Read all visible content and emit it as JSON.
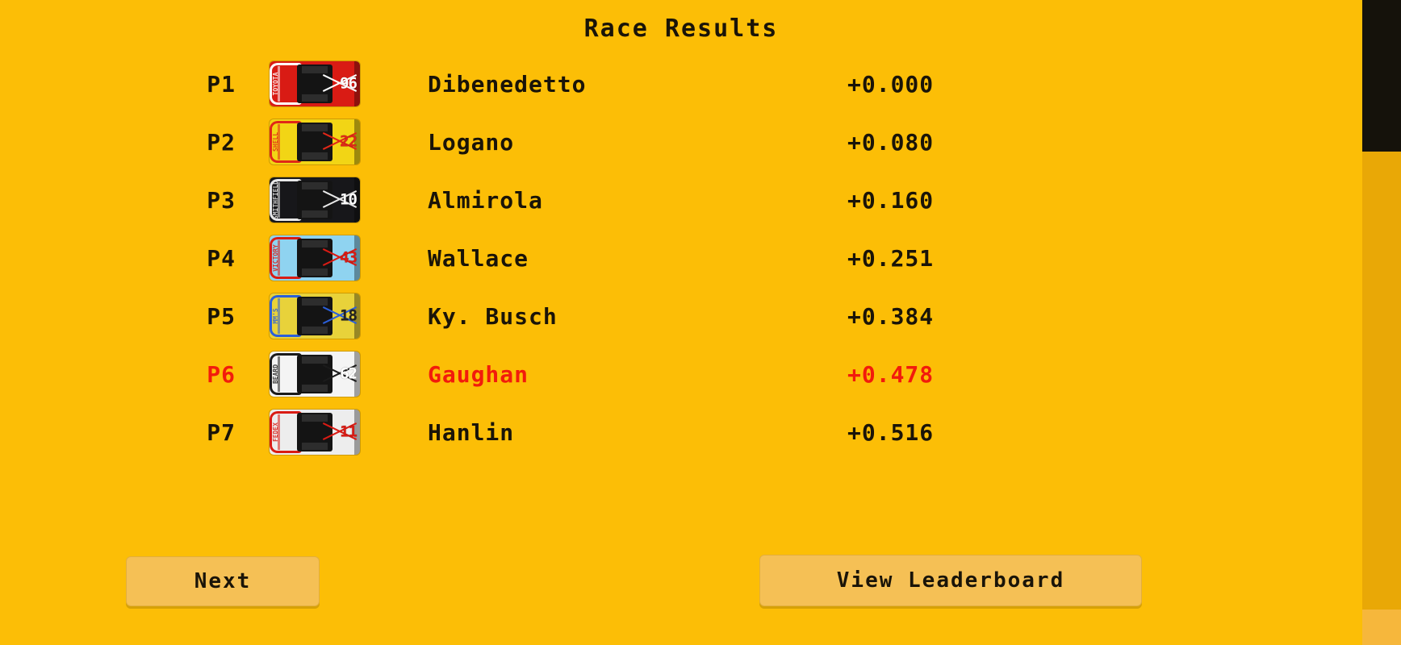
{
  "screen": {
    "title": "Race Results",
    "background_color": "#FCBE06",
    "text_color": "#1a1408",
    "highlight_color": "#F21B0C"
  },
  "results": {
    "rows": [
      {
        "position": "P1",
        "driver": "Dibenedetto",
        "gap": "+0.000",
        "highlighted": false,
        "car": {
          "number": "96",
          "body_color": "#D91B14",
          "accent_color": "#FFFFFF",
          "number_color": "#FFFFFF",
          "sponsor": "TOYOTA"
        }
      },
      {
        "position": "P2",
        "driver": "Logano",
        "gap": "+0.080",
        "highlighted": false,
        "car": {
          "number": "22",
          "body_color": "#F2D515",
          "accent_color": "#E02718",
          "number_color": "#E02718",
          "sponsor": "SHELL"
        }
      },
      {
        "position": "P3",
        "driver": "Almirola",
        "gap": "+0.160",
        "highlighted": false,
        "car": {
          "number": "10",
          "body_color": "#17171A",
          "accent_color": "#E8E8E8",
          "number_color": "#FFFFFF",
          "sponsor": "SMITHFIELD"
        }
      },
      {
        "position": "P4",
        "driver": "Wallace",
        "gap": "+0.251",
        "highlighted": false,
        "car": {
          "number": "43",
          "body_color": "#8FD3F0",
          "accent_color": "#D91B14",
          "number_color": "#D91B14",
          "sponsor": "VICTORY"
        }
      },
      {
        "position": "P5",
        "driver": "Ky. Busch",
        "gap": "+0.384",
        "highlighted": false,
        "car": {
          "number": "18",
          "body_color": "#E8D23A",
          "accent_color": "#2B5FD9",
          "number_color": "#222222",
          "sponsor": "MM'S"
        }
      },
      {
        "position": "P6",
        "driver": "Gaughan",
        "gap": "+0.478",
        "highlighted": true,
        "car": {
          "number": "62",
          "body_color": "#F4F4F4",
          "accent_color": "#1b1b1b",
          "number_color": "#FFFFFF",
          "sponsor": "BEARD"
        }
      },
      {
        "position": "P7",
        "driver": "Hanlin",
        "gap": "+0.516",
        "highlighted": false,
        "car": {
          "number": "11",
          "body_color": "#EDEDED",
          "accent_color": "#D91B14",
          "number_color": "#D91B14",
          "sponsor": "FEDEX"
        }
      }
    ]
  },
  "buttons": {
    "next": "Next",
    "leaderboard": "View Leaderboard"
  }
}
